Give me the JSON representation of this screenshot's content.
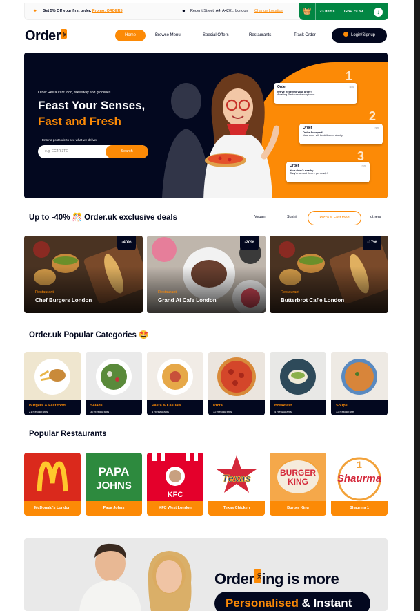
{
  "topbar": {
    "promo_text": "Get 5% Off your first order,",
    "promo_code": "Promo: ORDER5",
    "location": "Regent Street, A4, A4201, London",
    "change_location": "Change Location",
    "cart_items": "23 Items",
    "cart_total": "GBP 79.89"
  },
  "nav": {
    "logo": "Order",
    "logo_badge": "UK",
    "home": "Home",
    "browse": "Browse Menu",
    "offers": "Special Offers",
    "restaurants": "Restaurants",
    "track": "Track Order",
    "login": "Login/Signup"
  },
  "hero": {
    "subtitle": "Order Restaurant food, takeaway and groceries.",
    "title_line1": "Feast Your Senses,",
    "title_line2": "Fast and Fresh",
    "postcode_hint": "Enter a postcode to see what we deliver",
    "postcode_placeholder": "e.g. EC4R 3TE",
    "search_button": "Search",
    "notifications": [
      {
        "logo": "Order",
        "time": "now",
        "title": "We've Received your order!",
        "text": "Awaiting Restaurant acceptance"
      },
      {
        "logo": "Order",
        "time": "now",
        "title": "Order Accepted!",
        "text": "Your order will be delivered shortly"
      },
      {
        "logo": "Order",
        "time": "now",
        "title": "Your rider's nearby",
        "text": "They're almost there - get ready!"
      }
    ],
    "steps": [
      "1",
      "2",
      "3"
    ]
  },
  "deals": {
    "title": "Up to -40% 🎊 Order.uk exclusive deals",
    "filters": [
      "Vegan",
      "Sushi",
      "Pizza & Fast food",
      "others"
    ],
    "active_filter": "Pizza & Fast food",
    "items": [
      {
        "badge": "-40%",
        "label": "Restaurant",
        "name": "Chef Burgers London"
      },
      {
        "badge": "-20%",
        "label": "Restaurant",
        "name": "Grand Ai Cafe London"
      },
      {
        "badge": "-17%",
        "label": "Restaurant",
        "name": "Butterbrot Caf'e London"
      }
    ]
  },
  "categories": {
    "title": "Order.uk Popular Categories 🤩",
    "items": [
      {
        "name": "Burgers & Fast food",
        "count": "21 Restaurants"
      },
      {
        "name": "Salads",
        "count": "32 Restaurants"
      },
      {
        "name": "Pasta & Casuals",
        "count": "4 Restaurants"
      },
      {
        "name": "Pizza",
        "count": "32 Restaurants"
      },
      {
        "name": "Breakfast",
        "count": "4 Restaurants"
      },
      {
        "name": "Soups",
        "count": "32 Restaurants"
      }
    ]
  },
  "restaurants": {
    "title": "Popular Restaurants",
    "items": [
      {
        "name": "McDonald's London",
        "logo_text": "M"
      },
      {
        "name": "Papa Johns",
        "logo_text": "PAPA JOHNS"
      },
      {
        "name": "KFC West London",
        "logo_text": "KFC"
      },
      {
        "name": "Texas Chicken",
        "logo_text": "Texas"
      },
      {
        "name": "Burger King",
        "logo_text": "BURGER KING"
      },
      {
        "name": "Shaurma 1",
        "logo_text": "Shaurma"
      }
    ]
  },
  "banner": {
    "title_pre": "Order",
    "title_badge": "UK",
    "title_post": "ing is more",
    "sub_orange": "Personalised",
    "sub_white": " & Instant"
  },
  "colors": {
    "accent": "#fc8a06",
    "dark": "#03081f",
    "green": "#028643"
  }
}
